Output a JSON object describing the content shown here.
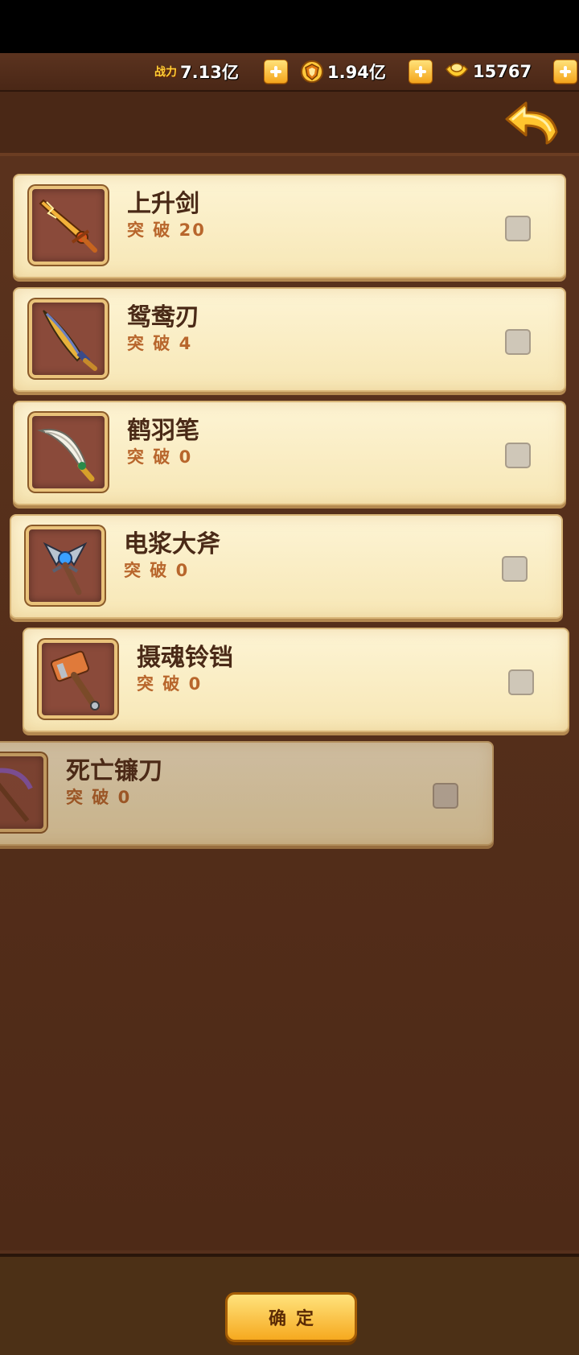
{
  "resources": {
    "power_tag": "战力",
    "power_value": "7.13亿",
    "shield_value": "1.94亿",
    "gold_value": "15767"
  },
  "items": [
    {
      "name": "上升剑",
      "break": "突 破 20",
      "icon": "rising-sword-icon",
      "checked": false
    },
    {
      "name": "鸳鸯刃",
      "break": "突 破 4",
      "icon": "curved-saber-icon",
      "checked": false
    },
    {
      "name": "鹤羽笔",
      "break": "突 破 0",
      "icon": "feather-blade-icon",
      "checked": false
    },
    {
      "name": "电浆大斧",
      "break": "突 破 0",
      "icon": "plasma-axe-icon",
      "checked": false
    },
    {
      "name": "摄魂铃铛",
      "break": "突 破 0",
      "icon": "hammer-icon",
      "checked": false
    },
    {
      "name": "死亡镰刀",
      "break": "突 破 0",
      "icon": "death-scythe-icon",
      "checked": false
    }
  ],
  "confirm_label": "确定",
  "colors": {
    "card_bg": "#fdf4d4",
    "panel_bg": "#56301c",
    "accent_gold": "#f6a91f"
  }
}
